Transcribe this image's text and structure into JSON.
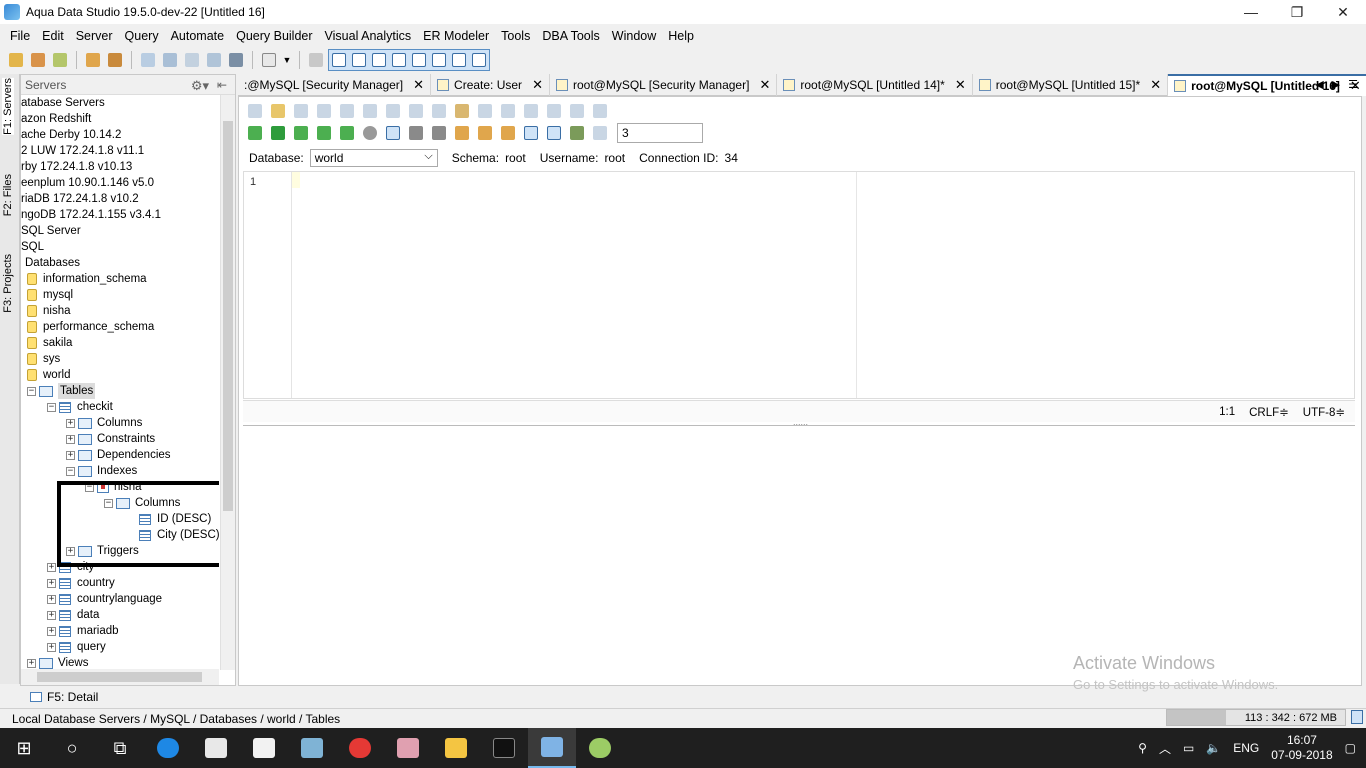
{
  "window": {
    "title": "Aqua Data Studio 19.5.0-dev-22 [Untitled 16]",
    "minimize": "—",
    "restore": "❐",
    "close": "✕"
  },
  "menu": [
    "File",
    "Edit",
    "Server",
    "Query",
    "Automate",
    "Query Builder",
    "Visual Analytics",
    "ER Modeler",
    "Tools",
    "DBA Tools",
    "Window",
    "Help"
  ],
  "side_tabs": {
    "servers": "F1: Servers",
    "files": "F2: Files",
    "projects": "F3: Projects"
  },
  "servers_panel": {
    "title": "Servers",
    "gear": "⚙▾",
    "pin": "⇤",
    "tree": {
      "local_servers": "atabase Servers",
      "redshift": "azon Redshift",
      "derby": "ache Derby 10.14.2",
      "db2": "2 LUW 172.24.1.8 v11.1",
      "derby2": "rby 172.24.1.8 v10.13",
      "greenplum": "eenplum 10.90.1.146 v5.0",
      "mariadb": "riaDB 172.24.1.8 v10.2",
      "mongodb": "ngoDB 172.24.1.155 v3.4.1",
      "sqlserver": " SQL Server",
      "mysql": "SQL",
      "databases": "Databases",
      "db_information_schema": "information_schema",
      "db_mysql": "mysql",
      "db_nisha": "nisha",
      "db_performance_schema": "performance_schema",
      "db_sakila": "sakila",
      "db_sys": "sys",
      "db_world": "world",
      "tables": "Tables",
      "checkit": "checkit",
      "columns": "Columns",
      "constraints": "Constraints",
      "dependencies": "Dependencies",
      "indexes": "Indexes",
      "index_nisha": "nisha",
      "idx_columns": "Columns",
      "col_id": "ID (DESC)",
      "col_city": "City (DESC)",
      "triggers": "Triggers",
      "t_city": "city",
      "t_country": "country",
      "t_countrylanguage": "countrylanguage",
      "t_data": "data",
      "t_mariadb": "mariadb",
      "t_query": "query",
      "views": "Views"
    }
  },
  "editor_tabs": [
    {
      "label": ":@MySQL [Security Manager]",
      "close": "✕"
    },
    {
      "label": "Create: User",
      "close": "✕"
    },
    {
      "label": "root@MySQL [Security Manager]",
      "close": "✕"
    },
    {
      "label": "root@MySQL [Untitled 14]*",
      "close": "✕"
    },
    {
      "label": "root@MySQL [Untitled 15]*",
      "close": "✕"
    },
    {
      "label": "root@MySQL [Untitled 16]",
      "close": "✕"
    }
  ],
  "tab_nav": {
    "prev": "◀",
    "next": "▶",
    "list": "☰"
  },
  "editor": {
    "max_rows": "3",
    "database_label": "Database:",
    "database_value": "world",
    "schema_label": "Schema:",
    "schema_value": "root",
    "username_label": "Username:",
    "username_value": "root",
    "connection_label": "Connection ID:",
    "connection_value": "34",
    "line_number": "1",
    "cursor_pos": "1:1",
    "line_ending": "CRLF≑",
    "encoding": "UTF-8≑",
    "splitter_grip": "......"
  },
  "watermark": {
    "line1": "Activate Windows",
    "line2": "Go to Settings to activate Windows."
  },
  "detail_tab": "F5: Detail",
  "status": {
    "breadcrumb": "Local Database Servers / MySQL / Databases / world / Tables",
    "memory": "113 : 342 : 672 MB",
    "memory_fraction": 0.33
  },
  "taskbar": {
    "language": "ENG",
    "time": "16:07",
    "date": "07-09-2018"
  },
  "colors": {
    "accent": "#3a6ea5",
    "taskbar": "#1f1f1f",
    "highlight_box": "#000000"
  }
}
